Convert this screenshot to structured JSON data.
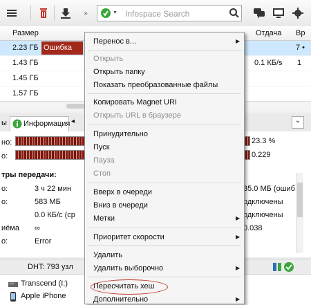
{
  "search": {
    "placeholder": "Infospace Search"
  },
  "header": {
    "size": "Размер",
    "upload": "Отдача",
    "extra": "Вр"
  },
  "files": [
    {
      "size": "2.23 ГБ",
      "status": "Ошибка",
      "selected": true
    },
    {
      "size": "1.43 ГБ",
      "upload": "0.1 КБ/s"
    },
    {
      "size": "1.45 ГБ"
    },
    {
      "size": "1.57 ГБ"
    }
  ],
  "right_col": [
    "7 •",
    "1",
    "",
    ""
  ],
  "tabs": {
    "info": "Информация",
    "left_partial": "ы"
  },
  "pane": {
    "row1_left": "но:",
    "row2_left": "о:",
    "pct": "23.3 %",
    "ratio": "0.229",
    "section": "тры передачи:",
    "l1": "о:",
    "v1": "3 ч 22 мин",
    "l2": "о:",
    "v2": "583 МБ",
    "v3": "0.0 КБ/с (ср",
    "l4": "иёма",
    "v4": "∞",
    "l5": "о:",
    "v5": "Error",
    "r1": "35.0 МБ (ошиб",
    "r2": "одключены",
    "r3": "одключены",
    "r4": "0.038"
  },
  "statusbar": {
    "dht": "DHT: 793 узл"
  },
  "bottom": {
    "drive": "Transcend (I:)",
    "phone": "Apple iPhone"
  },
  "menu": {
    "items": [
      {
        "label": "Перенос в...",
        "disabled": false,
        "arrow": true
      },
      {
        "label": "Открыть",
        "disabled": true
      },
      {
        "label": "Открыть папку",
        "disabled": false
      },
      {
        "label": "Показать преобразованные файлы",
        "disabled": false
      },
      {
        "label": "Копировать Magnet URI",
        "disabled": false
      },
      {
        "label": "Открыть URL в браузере",
        "disabled": true
      },
      {
        "label": "Принудительно",
        "disabled": false
      },
      {
        "label": "Пуск",
        "disabled": false
      },
      {
        "label": "Пауза",
        "disabled": true
      },
      {
        "label": "Стоп",
        "disabled": true
      },
      {
        "label": "Вверх в очереди",
        "disabled": false
      },
      {
        "label": "Вниз в очереди",
        "disabled": false
      },
      {
        "label": "Метки",
        "disabled": false,
        "arrow": true
      },
      {
        "label": "Приоритет скорости",
        "disabled": false,
        "arrow": true
      },
      {
        "label": "Удалить",
        "disabled": false
      },
      {
        "label": "Удалить выборочно",
        "disabled": false,
        "arrow": true
      },
      {
        "label": "Пересчитать хеш",
        "disabled": false,
        "highlighted": true
      },
      {
        "label": "Дополнительно",
        "disabled": false,
        "arrow": true
      }
    ]
  },
  "colors": {
    "error_bg": "#a32a1a",
    "highlight_ring": "#c0392b",
    "selection": "#cde8ff"
  }
}
